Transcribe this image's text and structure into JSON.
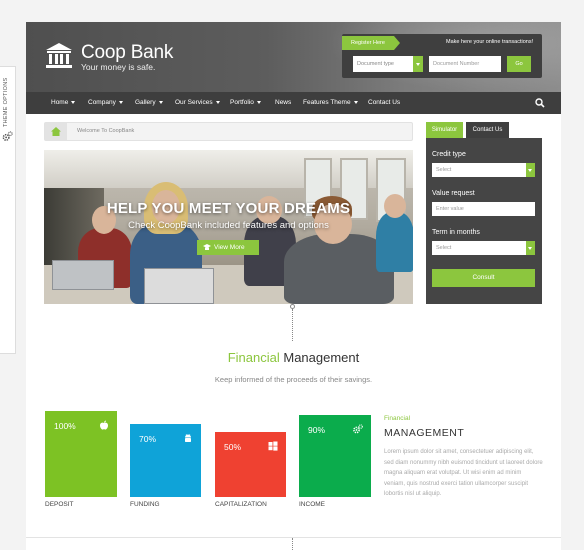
{
  "theme_options": {
    "label": "THEME OPTIONS",
    "icon": "gears-icon"
  },
  "header": {
    "brand": "Coop Bank",
    "tagline": "Your money is safe.",
    "logo_icon": "bank-building-icon",
    "register_label": "Register Here",
    "register_note": "Make here your online transactions!",
    "doc_type_placeholder": "Document type",
    "doc_number_placeholder": "Document Number",
    "go_label": "Go"
  },
  "nav": {
    "items": [
      {
        "label": "Home",
        "dropdown": true
      },
      {
        "label": "Company",
        "dropdown": true
      },
      {
        "label": "Gallery",
        "dropdown": true
      },
      {
        "label": "Our Services",
        "dropdown": true
      },
      {
        "label": "Portfolio",
        "dropdown": true
      },
      {
        "label": "News",
        "dropdown": false
      },
      {
        "label": "Features Theme",
        "dropdown": true
      },
      {
        "label": "Contact Us",
        "dropdown": false
      }
    ],
    "search_icon": "search-icon"
  },
  "breadcrumb": {
    "home_icon": "home-icon",
    "text": "Welcome To CoopBank"
  },
  "hero": {
    "title": "HELP YOU MEET YOUR DREAMS",
    "subtitle": "Check CoopBank included features and options",
    "button": "View More"
  },
  "simulator": {
    "tabs": [
      "Simulator",
      "Contact Us"
    ],
    "credit_type_label": "Credit type",
    "credit_type_value": "Select",
    "value_request_label": "Value request",
    "value_request_placeholder": "Enter value",
    "term_label": "Term in months",
    "term_value": "Select",
    "consult_label": "Consult"
  },
  "financial": {
    "title_green": "Financial",
    "title_rest": "Management",
    "subtitle": "Keep informed of the proceeds of their savings.",
    "tiles": [
      {
        "percent": "100%",
        "label": "DEPOSIT",
        "color": "#7dc224",
        "icon": "apple-icon"
      },
      {
        "percent": "70%",
        "label": "FUNDING",
        "color": "#0fa3d8",
        "icon": "android-icon"
      },
      {
        "percent": "50%",
        "label": "CAPITALIZATION",
        "color": "#ef4131",
        "icon": "windows-icon"
      },
      {
        "percent": "90%",
        "label": "INCOME",
        "color": "#0bac4c",
        "icon": "gears-icon"
      }
    ],
    "side_small": "Financial",
    "side_big": "MANAGEMENT",
    "side_body": "Lorem ipsum dolor sit amet, consectetuer adipiscing elit, sed diam nonummy nibh euismod tincidunt ut laoreet dolore magna aliquam erat volutpat. Ut wisi enim ad minim veniam, quis nostrud exerci tation ullamcorper suscipit lobortis nisl ut aliquip."
  },
  "colors": {
    "accent": "#8cc63e",
    "dark": "#3e3e3e"
  }
}
